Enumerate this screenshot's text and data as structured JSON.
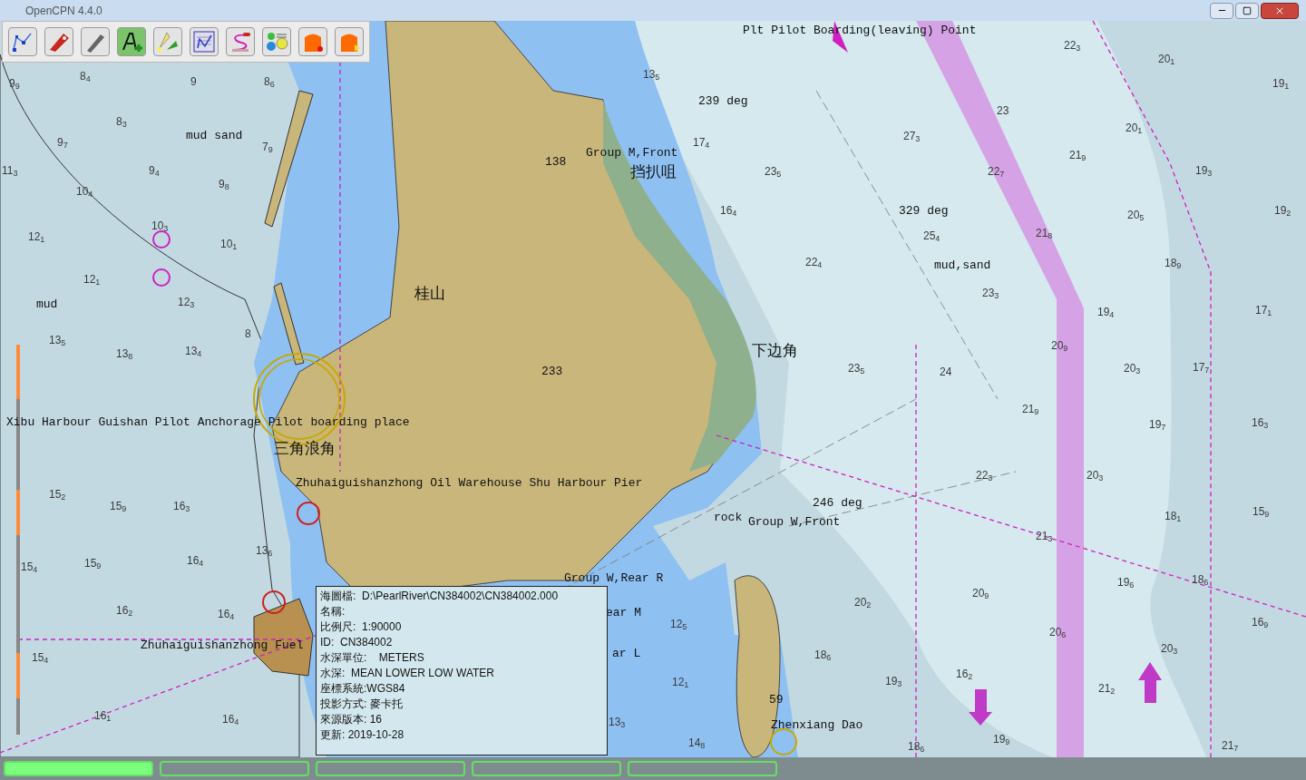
{
  "window": {
    "title": "OpenCPN 4.4.0"
  },
  "toolbar": [
    {
      "kind": "route"
    },
    {
      "kind": "ship"
    },
    {
      "kind": "tool"
    },
    {
      "kind": "text"
    },
    {
      "kind": "cone"
    },
    {
      "kind": "list"
    },
    {
      "kind": "track"
    },
    {
      "kind": "gauges"
    },
    {
      "kind": "record"
    },
    {
      "kind": "play"
    }
  ],
  "chart": {
    "labels": [
      {
        "text": "Plt Pilot Boarding(leaving) Point",
        "kind": "name"
      },
      {
        "text": "239 deg",
        "kind": "name"
      },
      {
        "text": "138",
        "kind": "name"
      },
      {
        "text": "Group M,Front",
        "kind": "name"
      },
      {
        "text": "挡扒咀",
        "kind": "place"
      },
      {
        "text": "329 deg",
        "kind": "name"
      },
      {
        "text": "mud,sand",
        "kind": "name"
      },
      {
        "text": "mud sand",
        "kind": "name"
      },
      {
        "text": "mud",
        "kind": "name"
      },
      {
        "text": "桂山",
        "kind": "place"
      },
      {
        "text": "233",
        "kind": "name"
      },
      {
        "text": "下边角",
        "kind": "place"
      },
      {
        "text": "Xibu Harbour Guishan Pilot Anchorage Pilot boarding place",
        "kind": "name"
      },
      {
        "text": "三角浪角",
        "kind": "place"
      },
      {
        "text": "Zhuhaiguishanzhong Oil Warehouse Shu Harbour Pier",
        "kind": "name"
      },
      {
        "text": "246 deg",
        "kind": "name"
      },
      {
        "text": "rock",
        "kind": "name"
      },
      {
        "text": "Group W,Front",
        "kind": "name"
      },
      {
        "text": "Group W,Rear R",
        "kind": "name"
      },
      {
        "text": "ear M",
        "kind": "name"
      },
      {
        "text": "ar L",
        "kind": "name"
      },
      {
        "text": "Zhuhaiguishanzhong Fuel",
        "kind": "name"
      },
      {
        "text": "59",
        "kind": "name"
      },
      {
        "text": "Zhenxiang Dao",
        "kind": "name"
      }
    ],
    "soundings": [
      "9$_{9}$",
      "8$_{4}$",
      "9",
      "8$_{6}$",
      "8$_{3}$",
      "9$_{7}$",
      "9$_{4}$",
      "9$_{8}$",
      "10$_{4}$",
      "7$_{9}$",
      "11$_{3}$",
      "12$_{1}$",
      "10$_{3}$",
      "10$_{1}$",
      "12$_{1}$",
      "12$_{3}$",
      "13$_{5}$",
      "13$_{8}$",
      "13$_{4}$",
      "8",
      "15$_{2}$",
      "15$_{9}$",
      "16$_{3}$",
      "15$_{4}$",
      "15$_{9}$",
      "16$_{4}$",
      "13$_{6}$",
      "16$_{2}$",
      "16$_{4}$",
      "15$_{4}$",
      "16$_{1}$",
      "16$_{4}$",
      "13$_{5}$",
      "17$_{4}$",
      "23$_{5}$",
      "16$_{4}$",
      "22$_{4}$",
      "23$_{5}$",
      "24",
      "27$_{3}$",
      "25$_{4}$",
      "23$_{3}$",
      "22$_{3}$",
      "20$_{1}$",
      "19$_{1}$",
      "23",
      "21$_{9}$",
      "22$_{7}$",
      "19$_{3}$",
      "20$_{1}$",
      "20$_{5}$",
      "19$_{2}$",
      "21$_{8}$",
      "18$_{9}$",
      "17$_{1}$",
      "19$_{4}$",
      "20$_{9}$",
      "20$_{3}$",
      "17$_{7}$",
      "21$_{9}$",
      "19$_{7}$",
      "16$_{3}$",
      "22$_{3}$",
      "20$_{3}$",
      "18$_{1}$",
      "15$_{9}$",
      "21$_{3}$",
      "19$_{6}$",
      "18$_{6}$",
      "20$_{9}$",
      "20$_{2}$",
      "20$_{6}$",
      "16$_{9}$",
      "12$_{5}$",
      "18$_{6}$",
      "12$_{1}$",
      "19$_{3}$",
      "16$_{2}$",
      "20$_{3}$",
      "21$_{2}$",
      "13$_{3}$",
      "14$_{8}$",
      "18$_{6}$",
      "19$_{9}$",
      "21$_{7}$"
    ]
  },
  "info_popup": {
    "lines": [
      "海圖檔:  D:\\PearlRiver\\CN384002\\CN384002.000",
      "名稱:",
      "比例尺:  1:90000",
      "ID:  CN384002",
      "水深單位:    METERS",
      "水深:  MEAN LOWER LOW WATER",
      "座標系統:WGS84",
      "投影方式: 麥卡托",
      "來源版本: 16",
      "更新: 2019-10-28"
    ]
  },
  "chart_bar": [
    {
      "selected": true
    },
    {
      "selected": false
    },
    {
      "selected": false
    },
    {
      "selected": false
    },
    {
      "selected": false
    }
  ]
}
